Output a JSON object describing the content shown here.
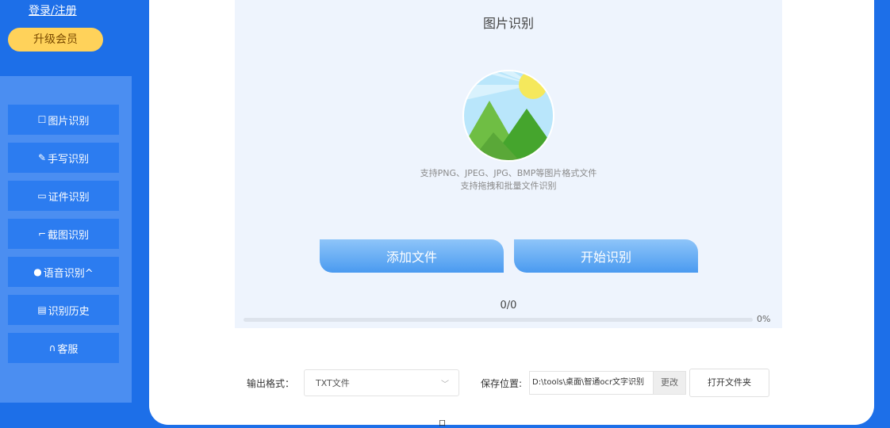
{
  "header": {
    "login_link": "登录/注册",
    "vip_button": "升级会员"
  },
  "sidebar": {
    "items": [
      {
        "icon": "image-icon",
        "glyph": "☐",
        "label": "图片识别"
      },
      {
        "icon": "pen-icon",
        "glyph": "✎",
        "label": "手写识别"
      },
      {
        "icon": "id-card-icon",
        "glyph": "▭",
        "label": "证件识别"
      },
      {
        "icon": "crop-icon",
        "glyph": "⌐",
        "label": "截图识别"
      },
      {
        "icon": "mic-icon",
        "glyph": "●",
        "label": "语音识别^"
      },
      {
        "icon": "history-icon",
        "glyph": "▤",
        "label": "识别历史"
      },
      {
        "icon": "headset-icon",
        "glyph": "∩",
        "label": "客服"
      }
    ]
  },
  "main": {
    "title": "图片识别",
    "hint_line1": "支持PNG、JPEG、JPG、BMP等图片格式文件",
    "hint_line2": "支持拖拽和批量文件识别",
    "add_file_button": "添加文件",
    "start_button": "开始识别",
    "progress_count": "0/0",
    "progress_percent": "0%",
    "progress_value": 0
  },
  "footer": {
    "format_label": "输出格式：",
    "format_value": "TXT文件",
    "save_label": "保存位置:",
    "save_path": "D:\\tools\\桌面\\智通ocr文字识别",
    "change_button": "更改",
    "open_folder_button": "打开文件夹",
    "bottom_glyph": "口"
  },
  "colors": {
    "background": "#1d6fe8",
    "vip": "#ffd25a",
    "nav_item": "#2c7cf0",
    "button": "#4a9af0"
  }
}
